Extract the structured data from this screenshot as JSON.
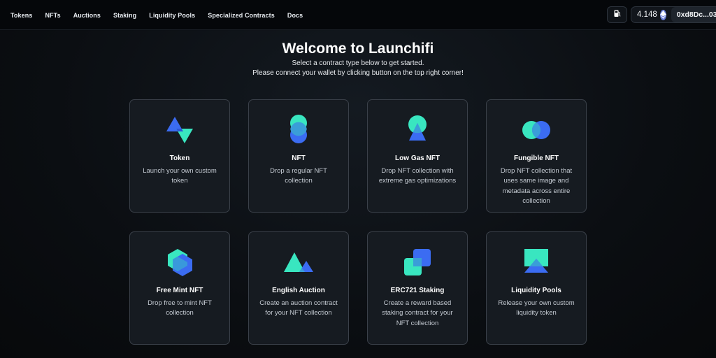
{
  "nav": {
    "items": [
      {
        "label": "Tokens"
      },
      {
        "label": "NFTs"
      },
      {
        "label": "Auctions"
      },
      {
        "label": "Staking"
      },
      {
        "label": "Liquidity Pools"
      },
      {
        "label": "Specialized Contracts"
      },
      {
        "label": "Docs"
      }
    ]
  },
  "wallet": {
    "gas_icon": "gas-pump-icon",
    "balance": "4.148",
    "currency_icon": "ethereum-icon",
    "address": "0xd8Dc...03"
  },
  "header": {
    "title": "Welcome to Launchifi",
    "subtitle_line1": "Select a contract type below to get started.",
    "subtitle_line2": "Please connect your wallet by clicking button on the top right corner!"
  },
  "cards": [
    {
      "title": "Token",
      "description": "Launch your own custom token",
      "icon": "token-icon"
    },
    {
      "title": "NFT",
      "description": "Drop a regular NFT collection",
      "icon": "nft-icon"
    },
    {
      "title": "Low Gas NFT",
      "description": "Drop NFT collection with extreme gas optimizations",
      "icon": "low-gas-nft-icon"
    },
    {
      "title": "Fungible NFT",
      "description": "Drop NFT collection that uses same image and metadata across entire collection",
      "icon": "fungible-nft-icon"
    },
    {
      "title": "Free Mint NFT",
      "description": "Drop free to mint NFT collection",
      "icon": "free-mint-nft-icon"
    },
    {
      "title": "English Auction",
      "description": "Create an auction contract for your NFT collection",
      "icon": "english-auction-icon"
    },
    {
      "title": "ERC721 Staking",
      "description": "Create a reward based staking contract for your NFT collection",
      "icon": "erc721-staking-icon"
    },
    {
      "title": "Liquidity Pools",
      "description": "Release your own custom liquidity token",
      "icon": "liquidity-pools-icon"
    }
  ],
  "colors": {
    "accent_teal": "#2ee6b8",
    "accent_blue": "#3a6df0",
    "background": "#0b0e12",
    "card_background": "#161b21"
  }
}
